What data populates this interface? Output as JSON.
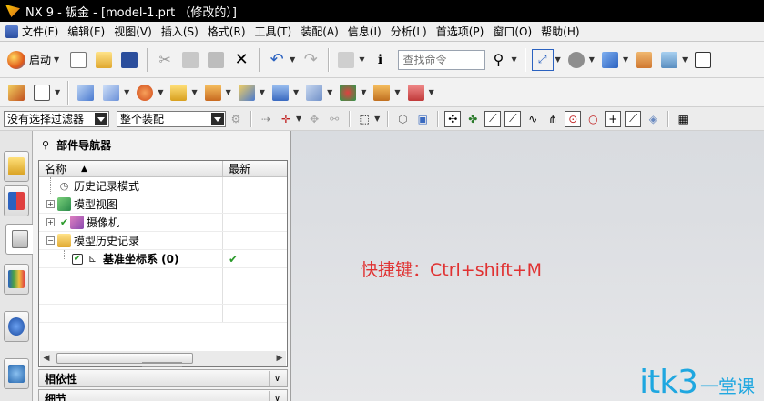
{
  "window": {
    "title": "NX 9 - 钣金 - [model-1.prt （修改的）]"
  },
  "menubar": {
    "items": [
      "文件(F)",
      "编辑(E)",
      "视图(V)",
      "插入(S)",
      "格式(R)",
      "工具(T)",
      "装配(A)",
      "信息(I)",
      "分析(L)",
      "首选项(P)",
      "窗口(O)",
      "帮助(H)"
    ]
  },
  "toolbar1": {
    "start_label": "启动",
    "search_placeholder": "查找命令"
  },
  "selection_bar": {
    "filter_value": "没有选择过滤器",
    "scope_value": "整个装配"
  },
  "part_navigator": {
    "title": "部件导航器",
    "columns": {
      "name": "名称",
      "latest": "最新"
    },
    "rows": [
      {
        "label": "历史记录模式",
        "icon": "clock-icon",
        "latest": ""
      },
      {
        "label": "模型视图",
        "icon": "views-icon",
        "latest": ""
      },
      {
        "label": "摄像机",
        "icon": "camera-icon",
        "latest": ""
      },
      {
        "label": "模型历史记录",
        "icon": "folder-icon",
        "latest": ""
      },
      {
        "label": "基准坐标系 (0)",
        "icon": "datum-csys-icon",
        "latest": "✔"
      }
    ],
    "panels": [
      "相依性",
      "细节"
    ]
  },
  "graphics": {
    "shortcut_note": "快捷键：Ctrl+shift+M",
    "watermark_big": "itk3",
    "watermark_small": "一堂课"
  },
  "colors": {
    "accent": "#1fa7e0",
    "note": "#e03232",
    "check": "#2a9a2a"
  }
}
